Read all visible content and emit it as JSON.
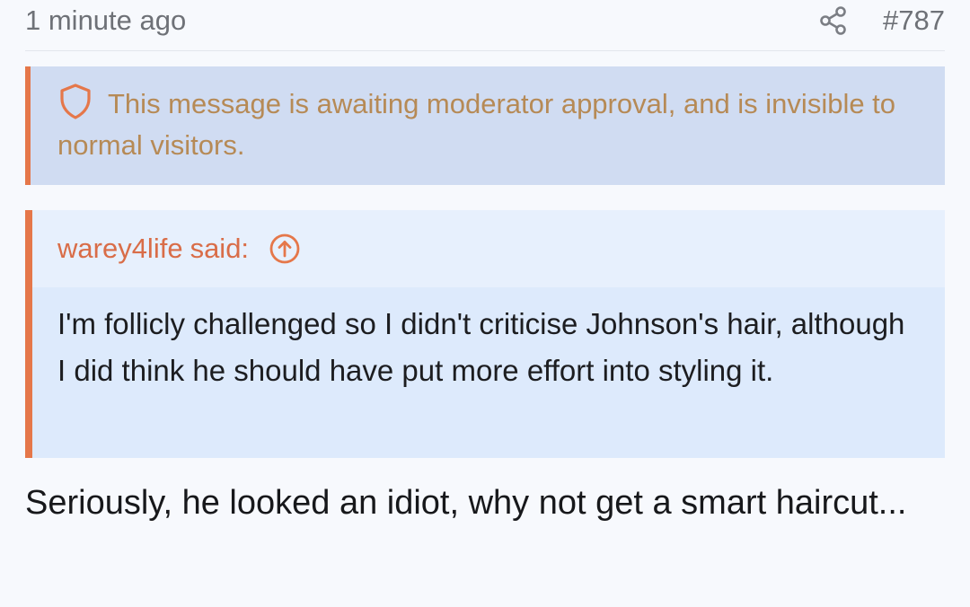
{
  "header": {
    "timestamp": "1 minute ago",
    "post_number": "#787",
    "share_icon": "share-icon"
  },
  "moderation": {
    "icon": "shield-icon",
    "text": "This message is awaiting moderator approval, and is invisible to normal visitors."
  },
  "quote": {
    "author": "warey4life",
    "said": "said:",
    "jump_icon": "arrow-up-circle-icon",
    "body": "I'm follicly challenged so I didn't criticise Johnson's hair, although I did think he should have put more effort into styling it."
  },
  "message": {
    "text": "Seriously, he looked an idiot, why not get a smart haircut..."
  },
  "colors": {
    "accent": "#e5774a",
    "notice_bg": "#d0dcf2",
    "notice_text": "#b68a56",
    "quote_bg": "#e7f0fd",
    "quote_body_bg": "#ddeafc",
    "page_bg": "#f7f9fd"
  }
}
